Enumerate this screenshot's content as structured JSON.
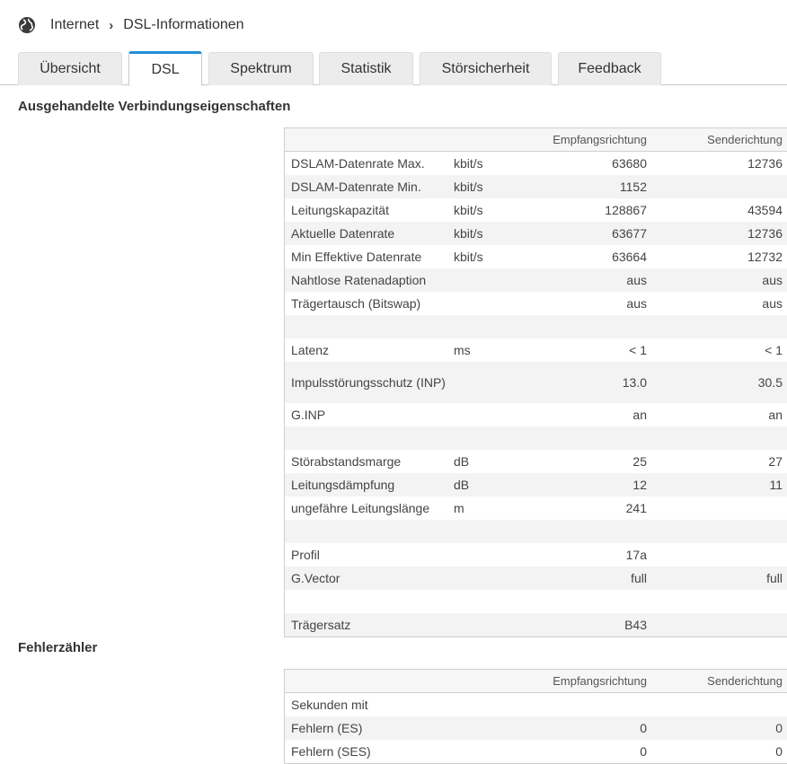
{
  "breadcrumb": {
    "root": "Internet",
    "current": "DSL-Informationen"
  },
  "tabs": [
    {
      "label": "Übersicht",
      "active": false
    },
    {
      "label": "DSL",
      "active": true
    },
    {
      "label": "Spektrum",
      "active": false
    },
    {
      "label": "Statistik",
      "active": false
    },
    {
      "label": "Störsicherheit",
      "active": false
    },
    {
      "label": "Feedback",
      "active": false
    }
  ],
  "section1": {
    "title": "Ausgehandelte Verbindungseigenschaften",
    "header": {
      "recv": "Empfangsrichtung",
      "send": "Senderichtung"
    },
    "rows": [
      {
        "label": "DSLAM-Datenrate Max.",
        "unit": "kbit/s",
        "recv": "63680",
        "send": "12736"
      },
      {
        "label": "DSLAM-Datenrate Min.",
        "unit": "kbit/s",
        "recv": "1152",
        "send": ""
      },
      {
        "label": "Leitungskapazität",
        "unit": "kbit/s",
        "recv": "128867",
        "send": "43594"
      },
      {
        "label": "Aktuelle Datenrate",
        "unit": "kbit/s",
        "recv": "63677",
        "send": "12736"
      },
      {
        "label": "Min Effektive Datenrate",
        "unit": "kbit/s",
        "recv": "63664",
        "send": "12732"
      },
      {
        "label": "Nahtlose Ratenadaption",
        "unit": "",
        "recv": "aus",
        "send": "aus"
      },
      {
        "label": "Trägertausch (Bitswap)",
        "unit": "",
        "recv": "aus",
        "send": "aus"
      },
      {
        "label": "",
        "unit": "",
        "recv": "",
        "send": ""
      },
      {
        "label": "Latenz",
        "unit": "ms",
        "recv": "< 1",
        "send": "< 1"
      },
      {
        "label": "Impulsstörungsschutz (INP)",
        "unit": "",
        "recv": "13.0",
        "send": "30.5",
        "tall": true
      },
      {
        "label": "G.INP",
        "unit": "",
        "recv": "an",
        "send": "an"
      },
      {
        "label": "",
        "unit": "",
        "recv": "",
        "send": ""
      },
      {
        "label": "Störabstandsmarge",
        "unit": "dB",
        "recv": "25",
        "send": "27"
      },
      {
        "label": "Leitungsdämpfung",
        "unit": "dB",
        "recv": "12",
        "send": "11"
      },
      {
        "label": "ungefähre Leitungslänge",
        "unit": "m",
        "recv": "241",
        "send": ""
      },
      {
        "label": "",
        "unit": "",
        "recv": "",
        "send": ""
      },
      {
        "label": "Profil",
        "unit": "",
        "recv": "17a",
        "send": ""
      },
      {
        "label": "G.Vector",
        "unit": "",
        "recv": "full",
        "send": "full"
      },
      {
        "label": "",
        "unit": "",
        "recv": "",
        "send": ""
      },
      {
        "label": "Trägersatz",
        "unit": "",
        "recv": "B43",
        "send": ""
      }
    ]
  },
  "section2": {
    "title": "Fehlerzähler",
    "header": {
      "recv": "Empfangsrichtung",
      "send": "Senderichtung"
    },
    "rows": [
      {
        "label": "Sekunden mit",
        "unit": "",
        "recv": "",
        "send": ""
      },
      {
        "label": "Fehlern (ES)",
        "unit": "",
        "recv": "0",
        "send": "0"
      },
      {
        "label": "Fehlern (SES)",
        "unit": "",
        "recv": "0",
        "send": "0"
      }
    ]
  }
}
